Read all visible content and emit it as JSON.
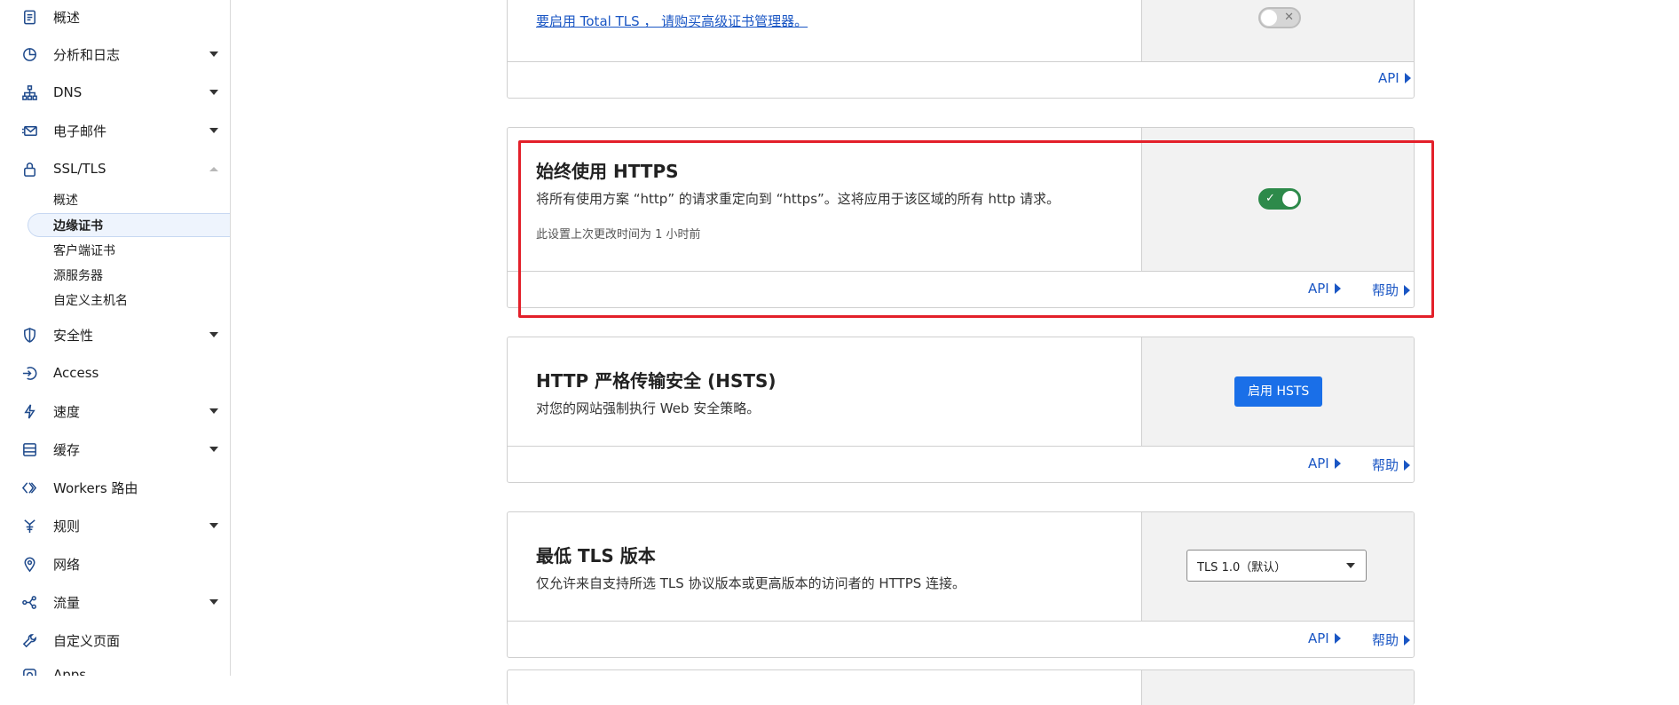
{
  "sidebar": {
    "items": [
      {
        "label": "概述",
        "icon": "document-icon"
      },
      {
        "label": "分析和日志",
        "icon": "chart-icon",
        "expandable": true
      },
      {
        "label": "DNS",
        "icon": "network-icon",
        "expandable": true
      },
      {
        "label": "电子邮件",
        "icon": "email-icon",
        "expandable": true
      },
      {
        "label": "SSL/TLS",
        "icon": "lock-icon",
        "expanded": true
      },
      {
        "label": "安全性",
        "icon": "shield-icon",
        "expandable": true
      },
      {
        "label": "Access",
        "icon": "access-icon"
      },
      {
        "label": "速度",
        "icon": "lightning-icon",
        "expandable": true
      },
      {
        "label": "缓存",
        "icon": "storage-icon",
        "expandable": true
      },
      {
        "label": "Workers 路由",
        "icon": "workers-icon"
      },
      {
        "label": "规则",
        "icon": "rules-icon",
        "expandable": true
      },
      {
        "label": "网络",
        "icon": "location-pin-icon"
      },
      {
        "label": "流量",
        "icon": "traffic-icon",
        "expandable": true
      },
      {
        "label": "自定义页面",
        "icon": "wrench-icon"
      },
      {
        "label": "Apps",
        "icon": "apps-icon"
      }
    ],
    "ssl_sub": [
      "概述",
      "边缘证书",
      "客户端证书",
      "源服务器",
      "自定义主机名"
    ],
    "ssl_active": "边缘证书"
  },
  "cards": {
    "total_tls": {
      "link": "要启用 Total TLS ， 请购买高级证书管理器。",
      "toggle": "off",
      "api": "API"
    },
    "always_https": {
      "title": "始终使用 HTTPS",
      "desc": "将所有使用方案 “http” 的请求重定向到 “https”。这将应用于该区域的所有 http 请求。",
      "meta": "此设置上次更改时间为 1 小时前",
      "toggle": "on",
      "api": "API",
      "help": "帮助"
    },
    "hsts": {
      "title": "HTTP 严格传输安全 (HSTS)",
      "desc": "对您的网站强制执行 Web 安全策略。",
      "button": "启用 HSTS",
      "api": "API",
      "help": "帮助"
    },
    "min_tls": {
      "title": "最低 TLS 版本",
      "desc": "仅允许来自支持所选 TLS 协议版本或更高版本的访问者的 HTTPS 连接。",
      "select_value": "TLS 1.0（默认）",
      "api": "API",
      "help": "帮助"
    }
  },
  "colors": {
    "link": "#1a56c4",
    "toggle_on": "#2d8a4a",
    "primary_button": "#1a6fe8",
    "highlight": "#e3202a"
  }
}
